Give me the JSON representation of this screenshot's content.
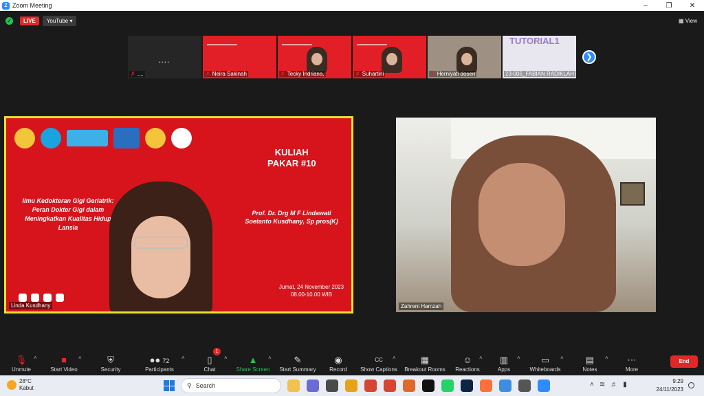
{
  "titlebar": {
    "logo": "Z",
    "title": "Zoom Meeting"
  },
  "meeting": {
    "live_label": "LIVE",
    "stream_label": "YouTube",
    "view_label": "View"
  },
  "filmstrip": [
    {
      "name": "....",
      "type": "dark"
    },
    {
      "name": "Neira Sakinah",
      "type": "slide"
    },
    {
      "name": "Tecky Indriana,",
      "type": "slide-person"
    },
    {
      "name": "Suhartini",
      "type": "slide-person"
    },
    {
      "name": "Herniyati dosen",
      "type": "cam"
    },
    {
      "name": "23-005_FABIAN RADIKLAH",
      "type": "slide2",
      "text": "TUTORIAL1"
    }
  ],
  "main": {
    "speaker": {
      "name": "Linda Kusdhany",
      "kuliah": "KULIAH",
      "pakar": "PAKAR #10",
      "title_line1": "Ilmu Kedokteran Gigi Geriatrik:",
      "title_line2": "Peran Dokter Gigi dalam",
      "title_line3": "Meningkatkan Kualitas Hidup",
      "title_line4": "Lansia",
      "prof_line1": "Prof. Dr. Drg M F Lindawati",
      "prof_line2": "Soetanto Kusdhany, Sp pros(K)",
      "date_line1": "Jumat, 24 November 2023",
      "date_line2": "08.00-10.00 WIB",
      "logo_kampus": "Kampus Merdeka",
      "logo_blu": "BLU",
      "logo_asiin": "ASIIN"
    },
    "right": {
      "name": "Zahreni Hamzah"
    }
  },
  "toolbar": {
    "unmute": "Unmute",
    "start_video": "Start Video",
    "security": "Security",
    "participants": "Participants",
    "participant_count": "72",
    "chat": "Chat",
    "chat_badge": "1",
    "share_screen": "Share Screen",
    "start_summary": "Start Summary",
    "record": "Record",
    "show_captions": "Show Captions",
    "breakout_rooms": "Breakout Rooms",
    "reactions": "Reactions",
    "apps": "Apps",
    "whiteboards": "Whiteboards",
    "notes": "Notes",
    "more": "More",
    "end": "End",
    "captions_icon_text": "CC"
  },
  "taskbar": {
    "temp": "28°C",
    "weather": "Kabut",
    "search": "Search",
    "time": "9:29",
    "date": "24/11/2023",
    "apps": [
      "file-explorer",
      "zoom-chat",
      "media",
      "folder",
      "office",
      "camera",
      "maps",
      "tiktok",
      "whatsapp",
      "photoshop",
      "firefox",
      "chrome",
      "settings",
      "zoom"
    ],
    "app_colors": [
      "#f2c14e",
      "#6b6bd6",
      "#4a4a4a",
      "#e6a31a",
      "#d64533",
      "#d64533",
      "#e06a2b",
      "#111111",
      "#25d366",
      "#0b2543",
      "#ff7139",
      "#3f8de0",
      "#555555",
      "#2d8cff"
    ]
  }
}
